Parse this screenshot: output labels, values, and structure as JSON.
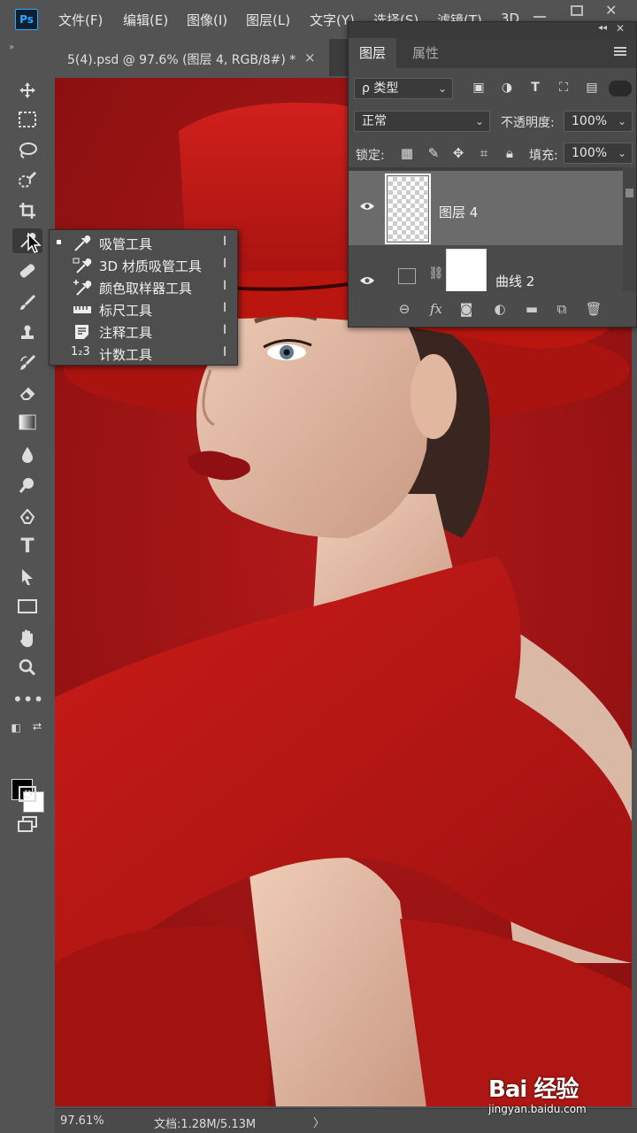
{
  "app": {
    "logo": "Ps"
  },
  "menu": [
    "文件(F)",
    "编辑(E)",
    "图像(I)",
    "图层(L)",
    "文字(Y)",
    "选择(S)",
    "滤镜(T)",
    "3D"
  ],
  "document": {
    "tab_title": "5(4).psd @ 97.6% (图层 4, RGB/8#) *",
    "close": "×"
  },
  "status": {
    "zoom": "97.61%",
    "doc_info": "文档:1.28M/5.13M",
    "arrow": "〉"
  },
  "flyout": {
    "items": [
      {
        "label": "吸管工具",
        "key": "I",
        "icon": "eyedropper-icon",
        "active": true
      },
      {
        "label": "3D 材质吸管工具",
        "key": "I",
        "icon": "3d-material-eyedropper-icon"
      },
      {
        "label": "颜色取样器工具",
        "key": "I",
        "icon": "color-sampler-icon"
      },
      {
        "label": "标尺工具",
        "key": "I",
        "icon": "ruler-icon"
      },
      {
        "label": "注释工具",
        "key": "I",
        "icon": "note-icon"
      },
      {
        "label": "计数工具",
        "key": "I",
        "icon": "count-icon",
        "icon_text": "1₂3"
      }
    ]
  },
  "layers_panel": {
    "tabs": [
      "图层",
      "属性"
    ],
    "filter_kind": "ρ 类型",
    "blend_mode": "正常",
    "opacity_label": "不透明度:",
    "opacity_value": "100%",
    "lock_label": "锁定:",
    "fill_label": "填充:",
    "fill_value": "100%",
    "layers": [
      {
        "name": "图层 4",
        "visible": true,
        "selected": true
      },
      {
        "name": "曲线 2",
        "visible": true,
        "selected": false
      }
    ],
    "footer_icons": [
      "link-layers-icon",
      "fx-icon",
      "mask-icon",
      "adjustment-icon",
      "group-icon",
      "new-layer-icon",
      "trash-icon"
    ],
    "fx_text": "fx"
  },
  "watermark": {
    "text": "Bai 经验",
    "url": "jingyan.baidu.com"
  },
  "colors": {
    "canvas_red": "#9c1313",
    "panel_bg": "#4b4b4b",
    "app_bg": "#535353",
    "selected_layer": "#6b6b6b"
  }
}
